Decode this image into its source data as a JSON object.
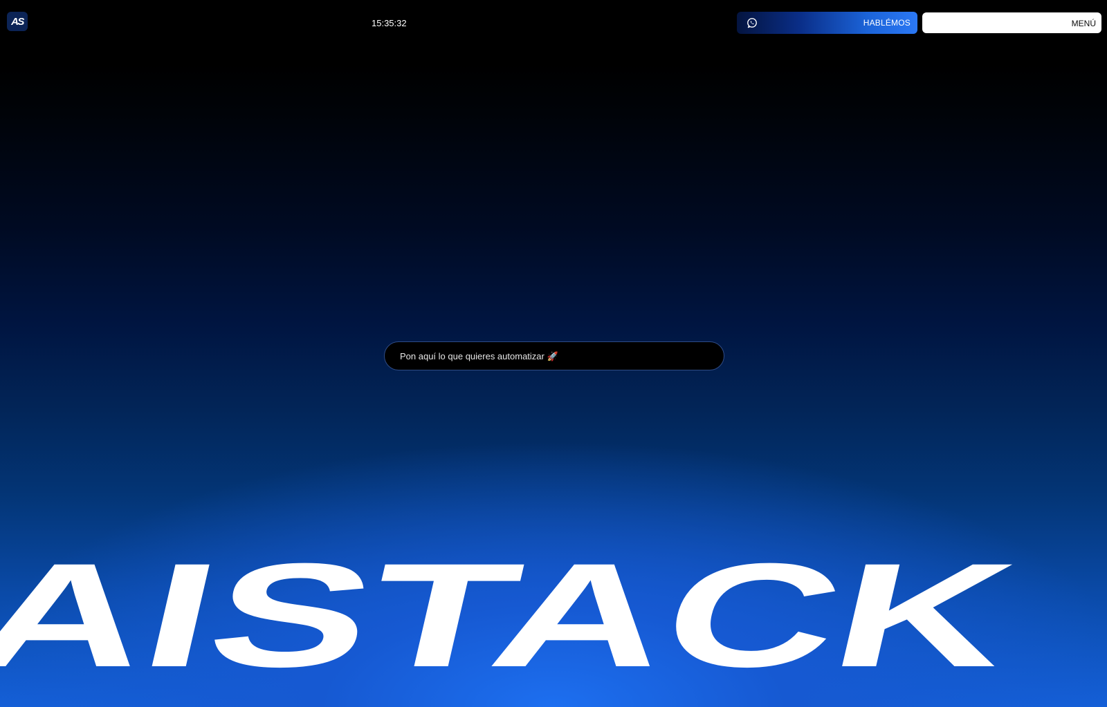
{
  "header": {
    "logo_text": "AS",
    "clock": "15:35:32",
    "talk_button": {
      "label": "HABLÉMOS",
      "icon": "whatsapp-icon"
    },
    "menu_button": {
      "label": "MENÚ"
    }
  },
  "hero": {
    "prompt_placeholder": "Pon aquí lo que quieres automatizar 🚀",
    "brand_word": "AISTACK"
  },
  "colors": {
    "background_top": "#000000",
    "background_bottom": "#1d6ff0",
    "talk_button_end": "#2b78f5",
    "menu_button_bg": "#ffffff",
    "wordmark": "#ffffff"
  }
}
